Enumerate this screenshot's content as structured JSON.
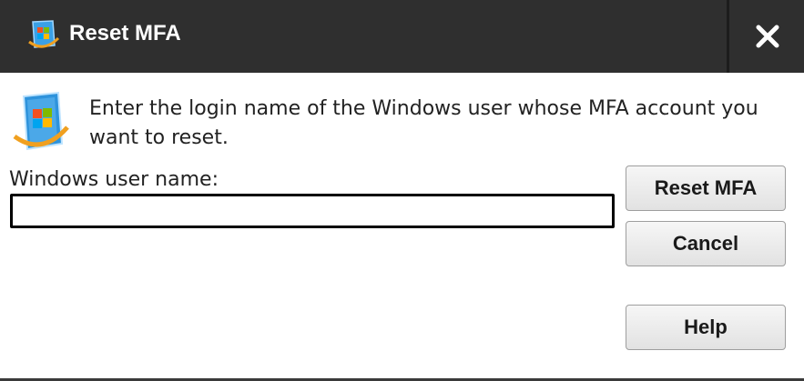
{
  "dialog": {
    "title": "Reset MFA",
    "message": "Enter the login name of the Windows user whose MFA account you want to reset.",
    "field_label": "Windows user name:",
    "username_value": "",
    "buttons": {
      "reset": "Reset MFA",
      "cancel": "Cancel",
      "help": "Help"
    },
    "icons": {
      "title": "windows-shield-icon",
      "app": "windows-shield-icon",
      "close": "close-icon"
    },
    "colors": {
      "titlebar": "#2f2f2f",
      "title_text": "#ffffff",
      "body": "#ffffff",
      "accent": "#1e8fd8"
    }
  }
}
